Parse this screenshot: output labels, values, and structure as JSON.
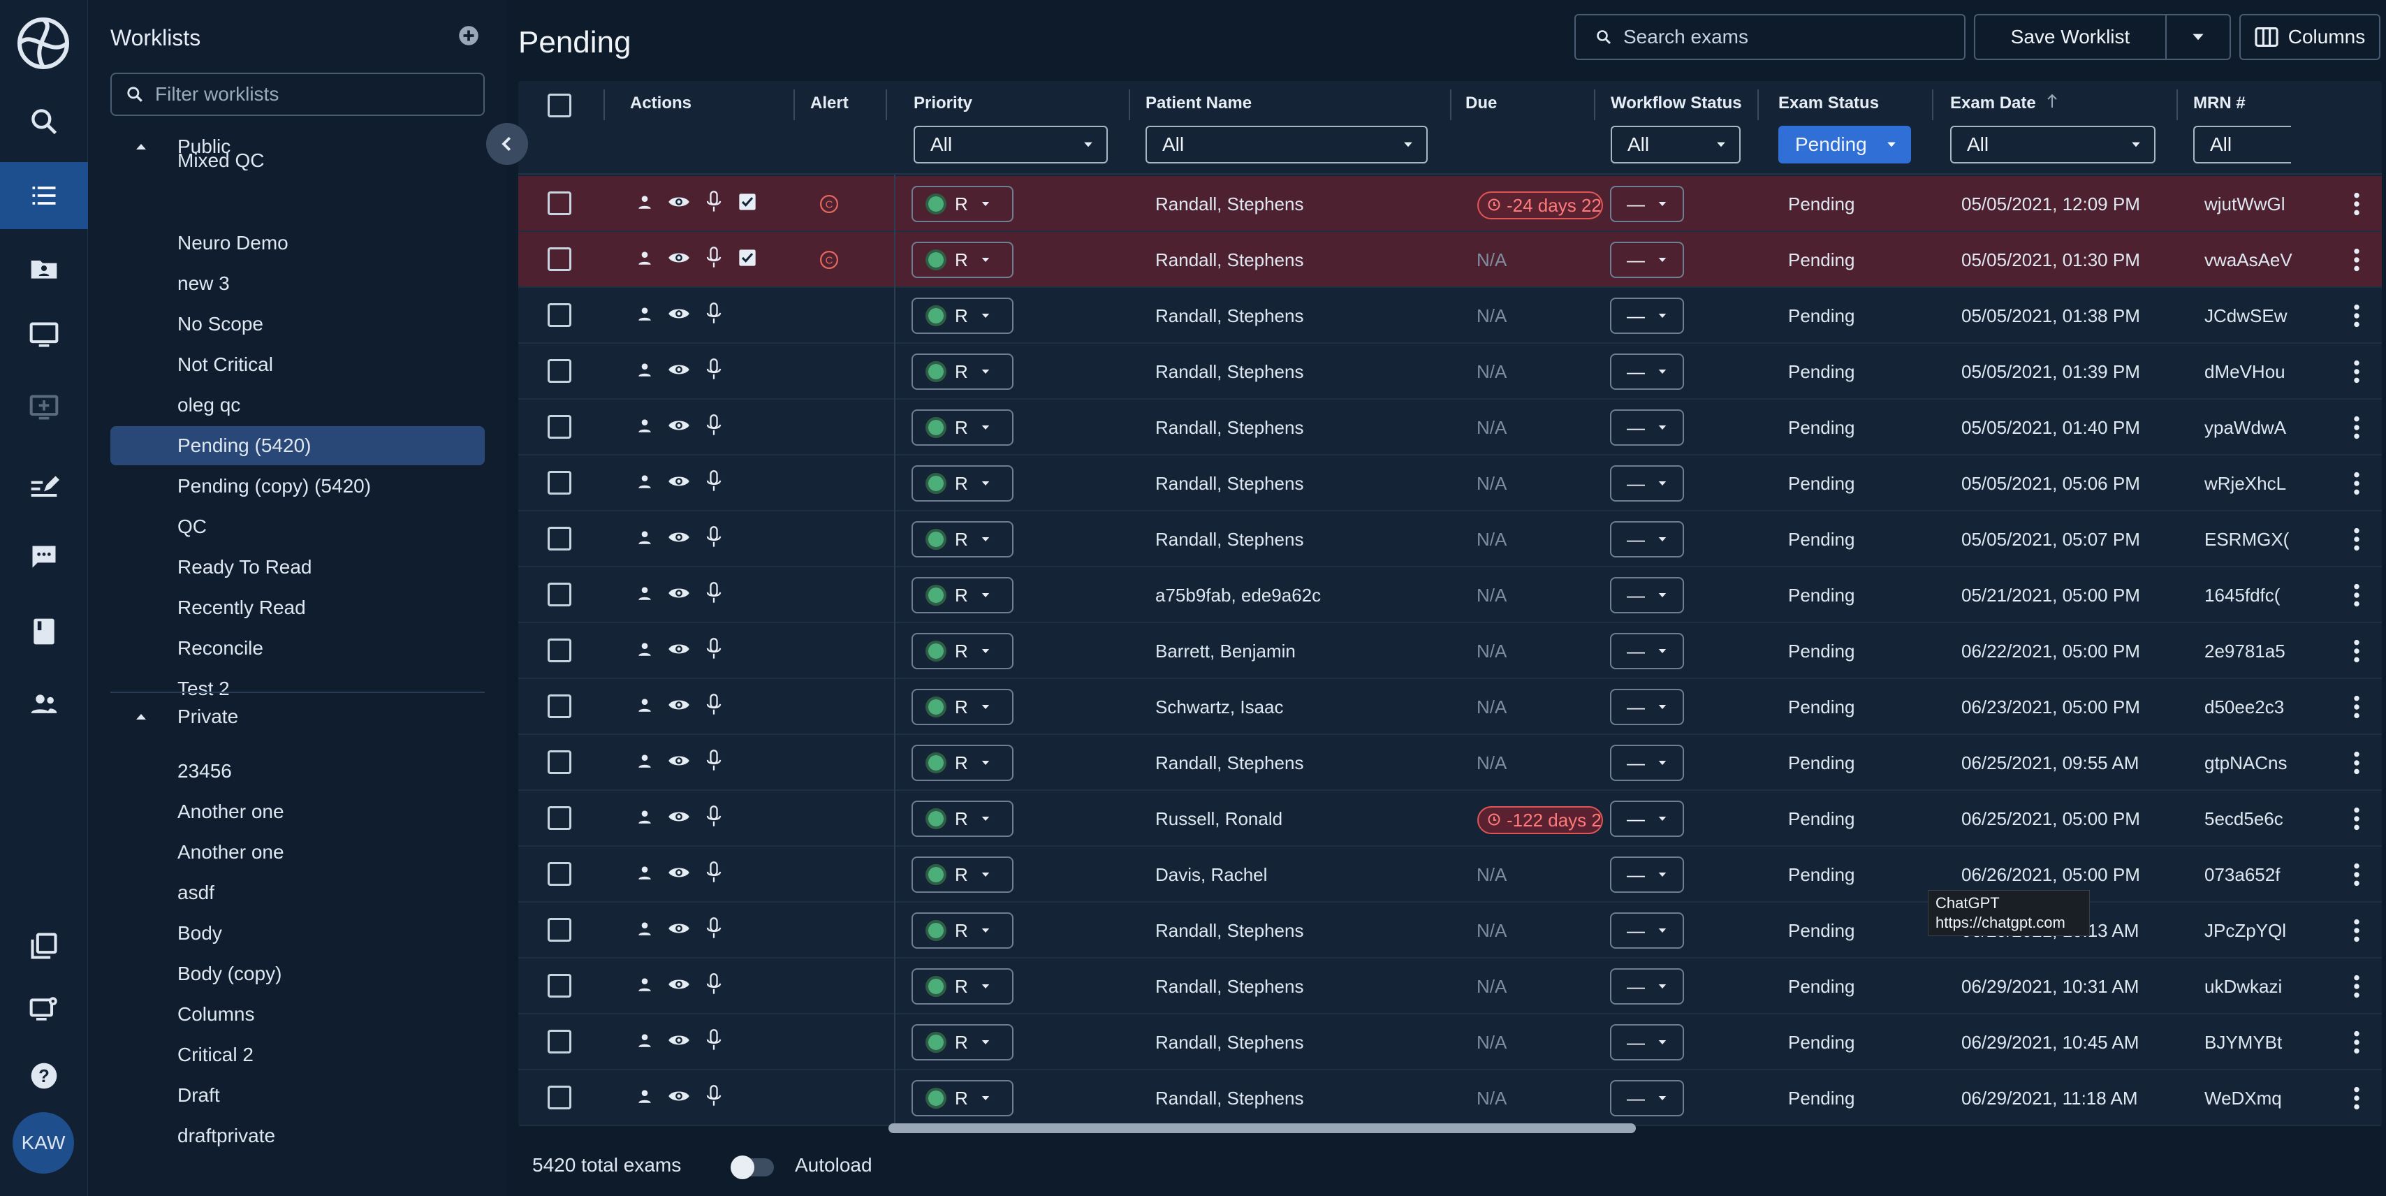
{
  "rail": {
    "avatar_initials": "KAW",
    "icons": [
      "logo-icon",
      "search-icon",
      "worklist-icon",
      "patient-folder-icon",
      "monitor-icon",
      "monitor-add-icon",
      "edit-list-icon",
      "chat-icon",
      "book-icon",
      "users-icon",
      "copy-icon",
      "monitor-settings-icon",
      "help-icon"
    ]
  },
  "sidebar": {
    "title": "Worklists",
    "filter_placeholder": "Filter worklists",
    "public_label": "Public",
    "private_label": "Private",
    "public_items": [
      "Mixed QC",
      "Neuro Demo",
      "new 3",
      "No Scope",
      "Not Critical",
      "oleg qc",
      "Pending (5420)",
      "Pending (copy) (5420)",
      "QC",
      "Ready To Read",
      "Recently Read",
      "Reconcile",
      "Test 2"
    ],
    "selected_item": "Pending (5420)",
    "private_items": [
      "23456",
      "Another one",
      "Another one",
      "asdf",
      "Body",
      "Body (copy)",
      "Columns",
      "Critical 2",
      "Draft",
      "draftprivate"
    ]
  },
  "header": {
    "title": "Pending",
    "search_placeholder": "Search exams",
    "save_label": "Save Worklist",
    "columns_label": "Columns"
  },
  "columns": {
    "actions": "Actions",
    "alert": "Alert",
    "priority": "Priority",
    "patient_name": "Patient Name",
    "due": "Due",
    "workflow_status": "Workflow Status",
    "exam_status": "Exam Status",
    "exam_date": "Exam Date",
    "mrn": "MRN #"
  },
  "filters": {
    "priority": "All",
    "patient_name": "All",
    "workflow_status": "All",
    "exam_status": "Pending",
    "exam_date": "All",
    "mrn": "All"
  },
  "rows": [
    {
      "patient": "Randall, Stephens",
      "due": "-24 days 22",
      "overdue": true,
      "alert": true,
      "wf": "—",
      "status": "Pending",
      "date": "05/05/2021, 12:09 PM",
      "mrn": "wjutWwGl"
    },
    {
      "patient": "Randall, Stephens",
      "due": "N/A",
      "overdue": false,
      "alert": true,
      "wf": "—",
      "status": "Pending",
      "date": "05/05/2021, 01:30 PM",
      "mrn": "vwaAsAeV"
    },
    {
      "patient": "Randall, Stephens",
      "due": "N/A",
      "overdue": false,
      "alert": false,
      "wf": "—",
      "status": "Pending",
      "date": "05/05/2021, 01:38 PM",
      "mrn": "JCdwSEw"
    },
    {
      "patient": "Randall, Stephens",
      "due": "N/A",
      "overdue": false,
      "alert": false,
      "wf": "—",
      "status": "Pending",
      "date": "05/05/2021, 01:39 PM",
      "mrn": "dMeVHou"
    },
    {
      "patient": "Randall, Stephens",
      "due": "N/A",
      "overdue": false,
      "alert": false,
      "wf": "—",
      "status": "Pending",
      "date": "05/05/2021, 01:40 PM",
      "mrn": "ypaWdwA"
    },
    {
      "patient": "Randall, Stephens",
      "due": "N/A",
      "overdue": false,
      "alert": false,
      "wf": "—",
      "status": "Pending",
      "date": "05/05/2021, 05:06 PM",
      "mrn": "wRjeXhcL"
    },
    {
      "patient": "Randall, Stephens",
      "due": "N/A",
      "overdue": false,
      "alert": false,
      "wf": "—",
      "status": "Pending",
      "date": "05/05/2021, 05:07 PM",
      "mrn": "ESRMGX("
    },
    {
      "patient": "a75b9fab, ede9a62c",
      "due": "N/A",
      "overdue": false,
      "alert": false,
      "wf": "—",
      "status": "Pending",
      "date": "05/21/2021, 05:00 PM",
      "mrn": "1645fdfc("
    },
    {
      "patient": "Barrett, Benjamin",
      "due": "N/A",
      "overdue": false,
      "alert": false,
      "wf": "—",
      "status": "Pending",
      "date": "06/22/2021, 05:00 PM",
      "mrn": "2e9781a5"
    },
    {
      "patient": "Schwartz, Isaac",
      "due": "N/A",
      "overdue": false,
      "alert": false,
      "wf": "—",
      "status": "Pending",
      "date": "06/23/2021, 05:00 PM",
      "mrn": "d50ee2c3"
    },
    {
      "patient": "Randall, Stephens",
      "due": "N/A",
      "overdue": false,
      "alert": false,
      "wf": "—",
      "status": "Pending",
      "date": "06/25/2021, 09:55 AM",
      "mrn": "gtpNACns"
    },
    {
      "patient": "Russell, Ronald",
      "due": "-122 days 2",
      "overdue": true,
      "alert": false,
      "wf": "—",
      "status": "Pending",
      "date": "06/25/2021, 05:00 PM",
      "mrn": "5ecd5e6c"
    },
    {
      "patient": "Davis, Rachel",
      "due": "N/A",
      "overdue": false,
      "alert": false,
      "wf": "—",
      "status": "Pending",
      "date": "06/26/2021, 05:00 PM",
      "mrn": "073a652f"
    },
    {
      "patient": "Randall, Stephens",
      "due": "N/A",
      "overdue": false,
      "alert": false,
      "wf": "—",
      "status": "Pending",
      "date": "06/29/2021, 10:13 AM",
      "mrn": "JPcZpYQl"
    },
    {
      "patient": "Randall, Stephens",
      "due": "N/A",
      "overdue": false,
      "alert": false,
      "wf": "—",
      "status": "Pending",
      "date": "06/29/2021, 10:31 AM",
      "mrn": "ukDwkazi"
    },
    {
      "patient": "Randall, Stephens",
      "due": "N/A",
      "overdue": false,
      "alert": false,
      "wf": "—",
      "status": "Pending",
      "date": "06/29/2021, 10:45 AM",
      "mrn": "BJYMYBt"
    },
    {
      "patient": "Randall, Stephens",
      "due": "N/A",
      "overdue": false,
      "alert": false,
      "wf": "—",
      "status": "Pending",
      "date": "06/29/2021, 11:18 AM",
      "mrn": "WeDXmq"
    }
  ],
  "priority_value": "R",
  "footer": {
    "total_label": "5420 total exams",
    "autoload_label": "Autoload"
  },
  "tooltip": {
    "line1": "ChatGPT",
    "line2": "https://chatgpt.com"
  }
}
